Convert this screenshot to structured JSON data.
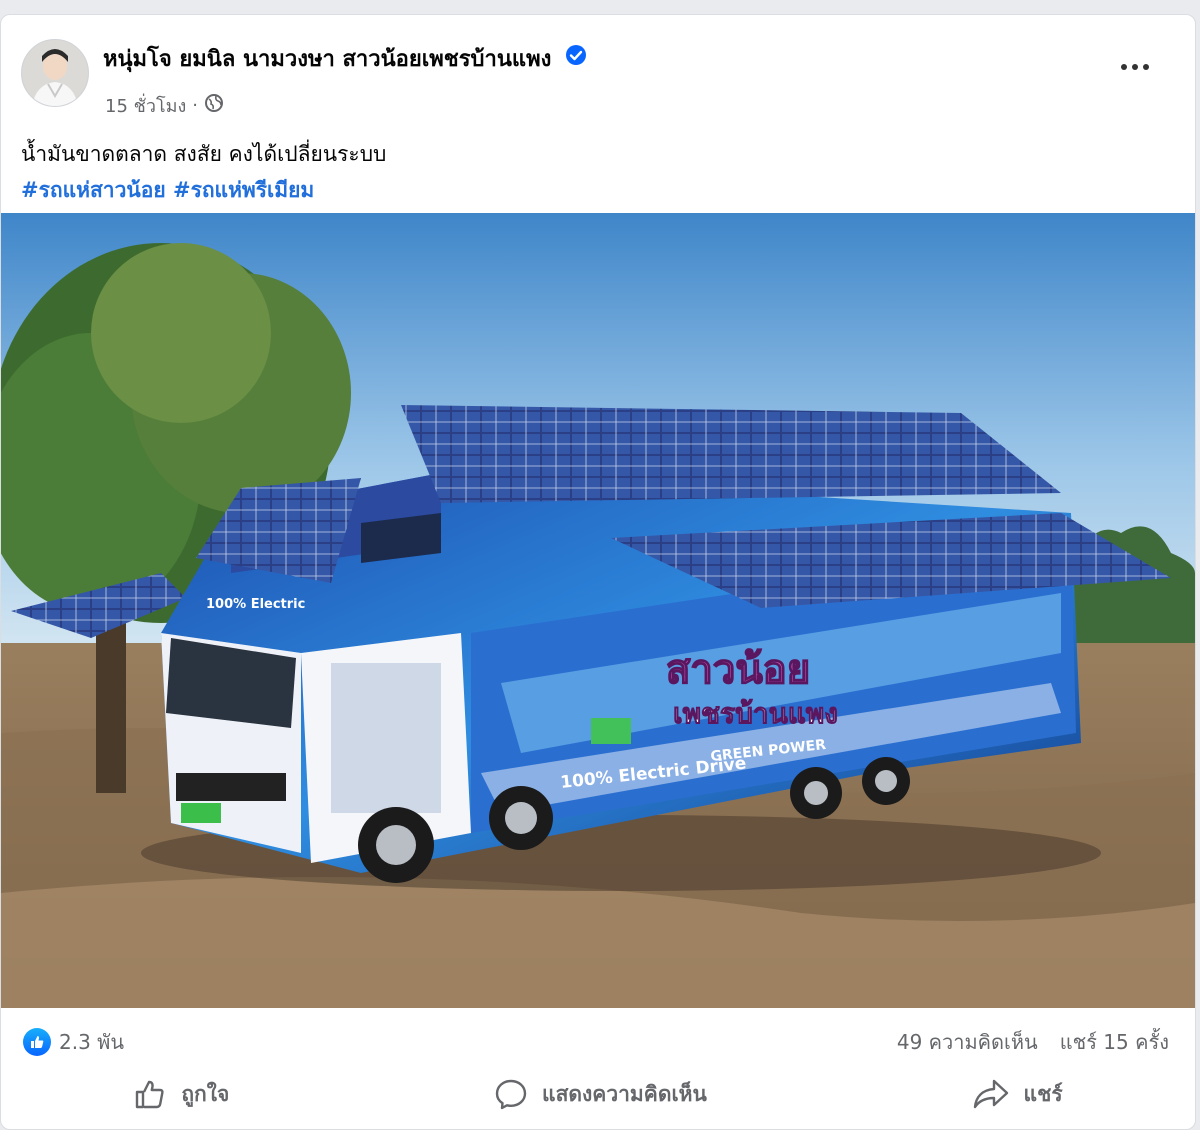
{
  "post": {
    "author": "หนุ่มโจ ยมนิล นามวงษา สาวน้อยเพชรบ้านแพง",
    "time": "15 ชั่วโมง",
    "separator": "·",
    "text": "น้ำมันขาดตลาด  สงสัย คงได้เปลี่ยนระบบ",
    "hashtags": [
      "#รถแห่สาวน้อย",
      "#รถแห่พรีเมียม"
    ]
  },
  "photo": {
    "bus_title_line1": "สาวน้อย",
    "bus_title_line2": "เพชรบ้านแพง",
    "bus_slogan": "100% Electric Drive",
    "bus_green": "GREEN POWER",
    "bus_front": "100% Electric"
  },
  "stats": {
    "likes": "2.3 พัน",
    "comments": "49 ความคิดเห็น",
    "shares": "แชร์ 15 ครั้ง"
  },
  "actions": {
    "like": "ถูกใจ",
    "comment": "แสดงความคิดเห็น",
    "share": "แชร์"
  },
  "colors": {
    "link": "#216fdb",
    "like_badge": "#0866ff",
    "secondary_text": "#65676b"
  }
}
